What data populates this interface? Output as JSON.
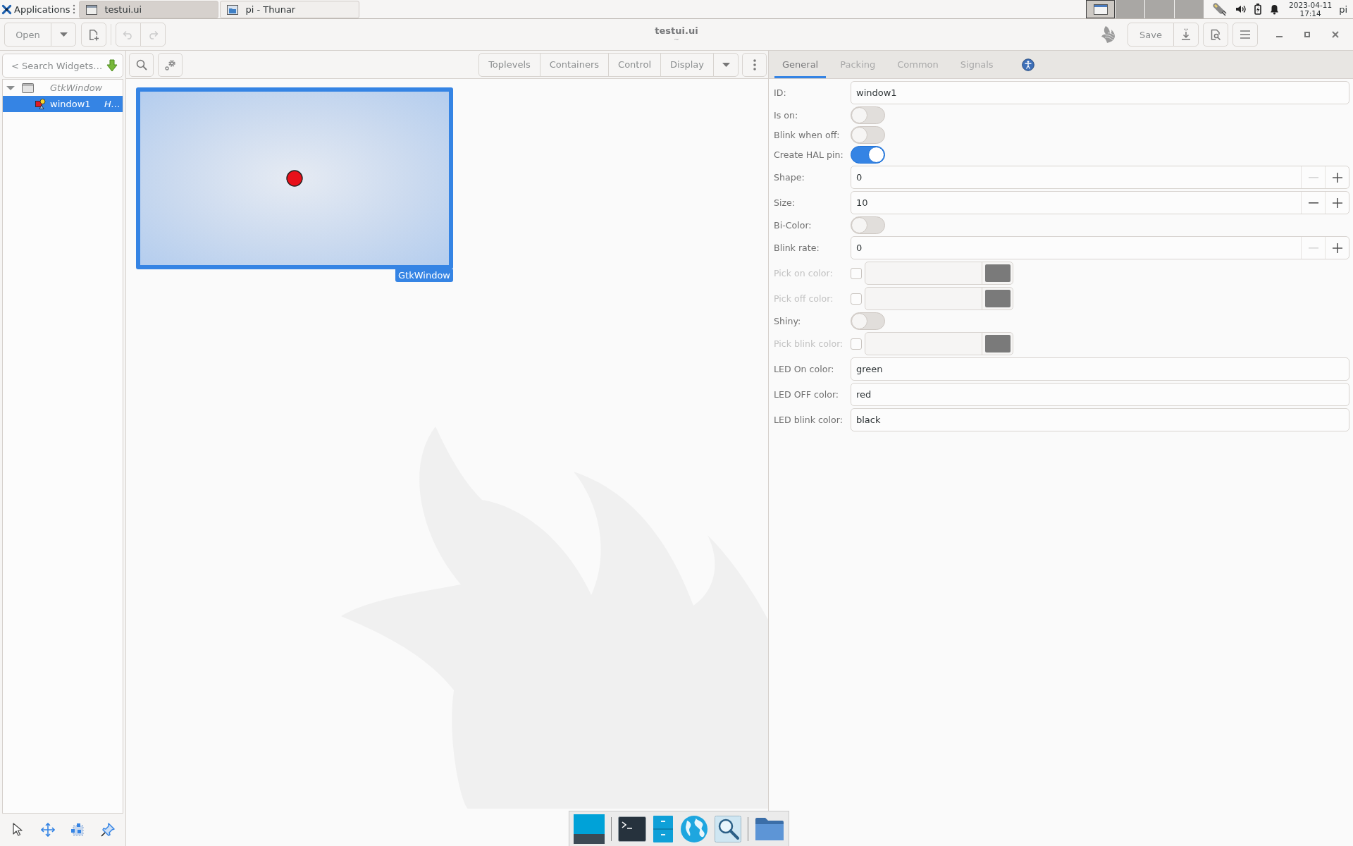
{
  "top_panel": {
    "applications": "Applications",
    "tasks": [
      {
        "title": "testui.ui",
        "selected": true
      },
      {
        "title": "pi - Thunar",
        "selected": false
      }
    ],
    "workspaces": [
      {
        "selected": true
      },
      {
        "selected": false
      },
      {
        "selected": false
      },
      {
        "selected": false
      }
    ],
    "clock": {
      "date": "2023-04-11",
      "time": "17:14"
    },
    "user": "pi"
  },
  "header_bar": {
    "open_button": "Open",
    "undo": {
      "disabled": true
    },
    "redo": {
      "disabled": true
    },
    "title": "testui.ui",
    "subtitle": "~",
    "save_button": "Save"
  },
  "inspector": {
    "search": {
      "placeholder": "< Search Widgets…"
    },
    "tree": [
      {
        "type": "GtkWindow",
        "expanded": true,
        "selected": false,
        "children": [
          {
            "name": "window1",
            "type": "H…",
            "selected": true
          }
        ]
      }
    ]
  },
  "palette": {
    "categories": [
      "Toplevels",
      "Containers",
      "Control",
      "Display"
    ]
  },
  "canvas": {
    "led": {
      "on": false
    },
    "selection_label": "GtkWindow"
  },
  "properties": {
    "tabs": [
      {
        "kind": "text",
        "label": "General",
        "selected": true
      },
      {
        "kind": "text",
        "label": "Packing",
        "selected": false
      },
      {
        "kind": "text",
        "label": "Common",
        "selected": false
      },
      {
        "kind": "text",
        "label": "Signals",
        "selected": false
      },
      {
        "kind": "accessibility",
        "selected": false
      }
    ],
    "rows": [
      {
        "kind": "entry",
        "label": "ID:",
        "value": "window1",
        "disabled": false
      },
      {
        "kind": "switch",
        "label": "Is on:",
        "on": false,
        "disabled": false
      },
      {
        "kind": "switch",
        "label": "Blink when off:",
        "on": false,
        "disabled": false
      },
      {
        "kind": "switch",
        "label": "Create HAL pin:",
        "on": true,
        "disabled": false
      },
      {
        "kind": "spin",
        "label": "Shape:",
        "value": "0",
        "decrement_disabled": true,
        "disabled": false
      },
      {
        "kind": "spin",
        "label": "Size:",
        "value": "10",
        "decrement_disabled": false,
        "disabled": false
      },
      {
        "kind": "switch",
        "label": "Bi-Color:",
        "on": false,
        "disabled": false
      },
      {
        "kind": "spin",
        "label": "Blink rate:",
        "value": "0",
        "decrement_disabled": true,
        "disabled": false
      },
      {
        "kind": "color",
        "label": "Pick on color:",
        "checked": false,
        "disabled": true
      },
      {
        "kind": "color",
        "label": "Pick off color:",
        "checked": false,
        "disabled": true
      },
      {
        "kind": "switch",
        "label": "Shiny:",
        "on": false,
        "disabled": false
      },
      {
        "kind": "color",
        "label": "Pick blink color:",
        "checked": false,
        "disabled": true
      },
      {
        "kind": "entry",
        "label": "LED On color:",
        "value": "green",
        "disabled": false
      },
      {
        "kind": "entry",
        "label": "LED OFF color:",
        "value": "red",
        "disabled": false
      },
      {
        "kind": "entry",
        "label": "LED blink color:",
        "value": "black",
        "disabled": false
      }
    ]
  }
}
